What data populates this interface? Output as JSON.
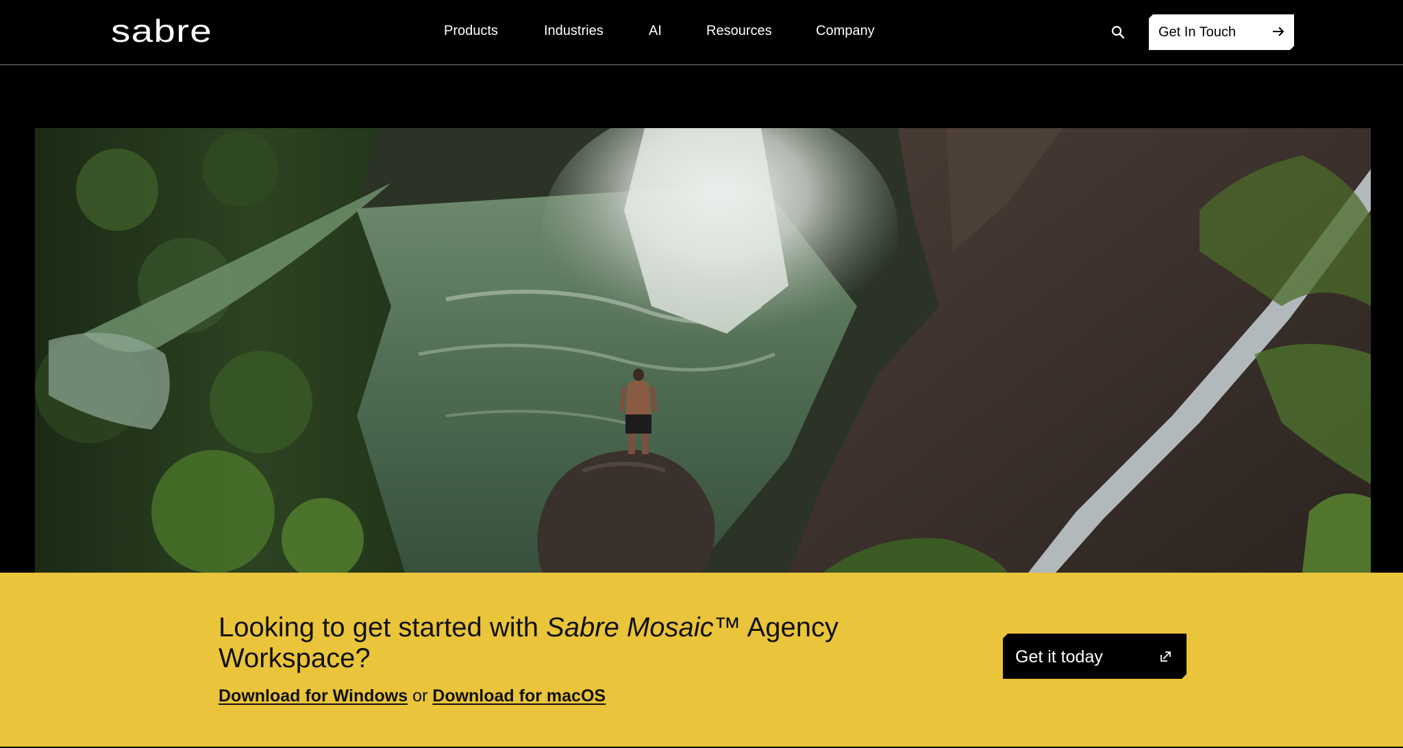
{
  "brand": {
    "logo_text": "sabre"
  },
  "nav": {
    "items": [
      {
        "label": "Products"
      },
      {
        "label": "Industries"
      },
      {
        "label": "AI"
      },
      {
        "label": "Resources"
      },
      {
        "label": "Company"
      }
    ],
    "search_icon": "search-icon",
    "cta_label": "Get In Touch",
    "cta_icon": "arrow-right-icon"
  },
  "hero": {
    "image": "photo: person standing on rock above a jungle waterfall pool"
  },
  "promo": {
    "headline_before": "Looking to get started with ",
    "headline_product": "Sabre Mosaic™",
    "headline_after": " Agency Workspace?",
    "download_windows": "Download for Windows",
    "download_separator": " or ",
    "download_macos": "Download for macOS",
    "cta_label": "Get it today",
    "cta_icon": "external-link-icon"
  },
  "colors": {
    "header_bg": "#000000",
    "band_bg": "#eac43a",
    "text_dark": "#111111"
  }
}
